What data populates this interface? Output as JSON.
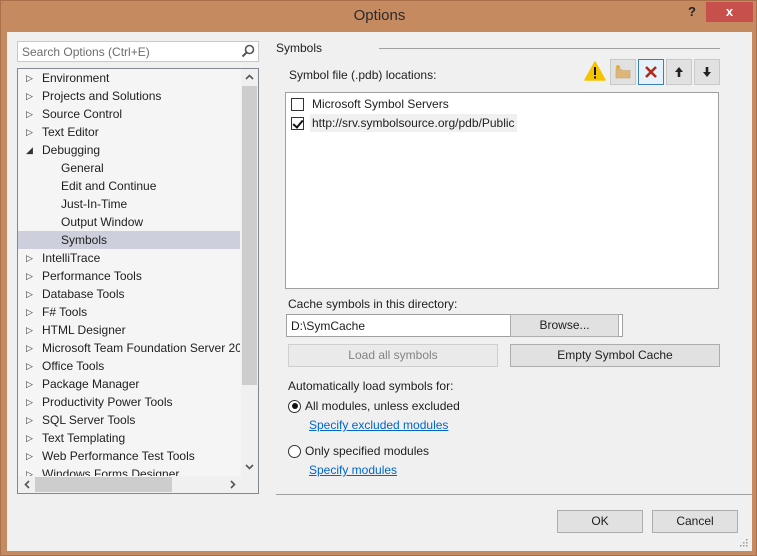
{
  "window": {
    "title": "Options",
    "help_label": "?",
    "close_label": "x"
  },
  "search": {
    "placeholder": "Search Options (Ctrl+E)",
    "value": ""
  },
  "tree": {
    "items": [
      {
        "label": "Environment",
        "level": 0,
        "expanded": false,
        "selected": false
      },
      {
        "label": "Projects and Solutions",
        "level": 0,
        "expanded": false,
        "selected": false
      },
      {
        "label": "Source Control",
        "level": 0,
        "expanded": false,
        "selected": false
      },
      {
        "label": "Text Editor",
        "level": 0,
        "expanded": false,
        "selected": false
      },
      {
        "label": "Debugging",
        "level": 0,
        "expanded": true,
        "selected": false
      },
      {
        "label": "General",
        "level": 1,
        "selected": false
      },
      {
        "label": "Edit and Continue",
        "level": 1,
        "selected": false
      },
      {
        "label": "Just-In-Time",
        "level": 1,
        "selected": false
      },
      {
        "label": "Output Window",
        "level": 1,
        "selected": false
      },
      {
        "label": "Symbols",
        "level": 1,
        "selected": true
      },
      {
        "label": "IntelliTrace",
        "level": 0,
        "expanded": false,
        "selected": false
      },
      {
        "label": "Performance Tools",
        "level": 0,
        "expanded": false,
        "selected": false
      },
      {
        "label": "Database Tools",
        "level": 0,
        "expanded": false,
        "selected": false
      },
      {
        "label": "F# Tools",
        "level": 0,
        "expanded": false,
        "selected": false
      },
      {
        "label": "HTML Designer",
        "level": 0,
        "expanded": false,
        "selected": false
      },
      {
        "label": "Microsoft Team Foundation Server 20",
        "level": 0,
        "expanded": false,
        "selected": false
      },
      {
        "label": "Office Tools",
        "level": 0,
        "expanded": false,
        "selected": false
      },
      {
        "label": "Package Manager",
        "level": 0,
        "expanded": false,
        "selected": false
      },
      {
        "label": "Productivity Power Tools",
        "level": 0,
        "expanded": false,
        "selected": false
      },
      {
        "label": "SQL Server Tools",
        "level": 0,
        "expanded": false,
        "selected": false
      },
      {
        "label": "Text Templating",
        "level": 0,
        "expanded": false,
        "selected": false
      },
      {
        "label": "Web Performance Test Tools",
        "level": 0,
        "expanded": false,
        "selected": false
      },
      {
        "label": "Windows Forms Designer",
        "level": 0,
        "expanded": false,
        "selected": false
      }
    ]
  },
  "panel": {
    "section_title": "Symbols",
    "locations_label": "Symbol file (.pdb) locations:",
    "toolbar": {
      "warning_icon": "warning-icon",
      "new_folder_icon": "new-folder-icon",
      "delete_icon": "delete-icon",
      "move_up_icon": "arrow-up-icon",
      "move_down_icon": "arrow-down-icon"
    },
    "locations": [
      {
        "label": "Microsoft Symbol Servers",
        "checked": false
      },
      {
        "label": "http://srv.symbolsource.org/pdb/Public",
        "checked": true
      }
    ],
    "cache_label": "Cache symbols in this directory:",
    "cache_value": "D:\\SymCache",
    "browse_label": "Browse...",
    "load_all_label": "Load all symbols",
    "empty_cache_label": "Empty Symbol Cache",
    "auto_load_label": "Automatically load symbols for:",
    "options": [
      {
        "label": "All modules, unless excluded",
        "selected": true,
        "link": "Specify excluded modules"
      },
      {
        "label": "Only specified modules",
        "selected": false,
        "link": "Specify modules"
      }
    ]
  },
  "footer": {
    "ok_label": "OK",
    "cancel_label": "Cancel"
  },
  "colors": {
    "frame": "#c68a60",
    "close": "#c7504c",
    "selection": "#cdd0dc",
    "link": "#0066cc",
    "delete_x": "#b02a1a",
    "warning": "#f5c400"
  }
}
